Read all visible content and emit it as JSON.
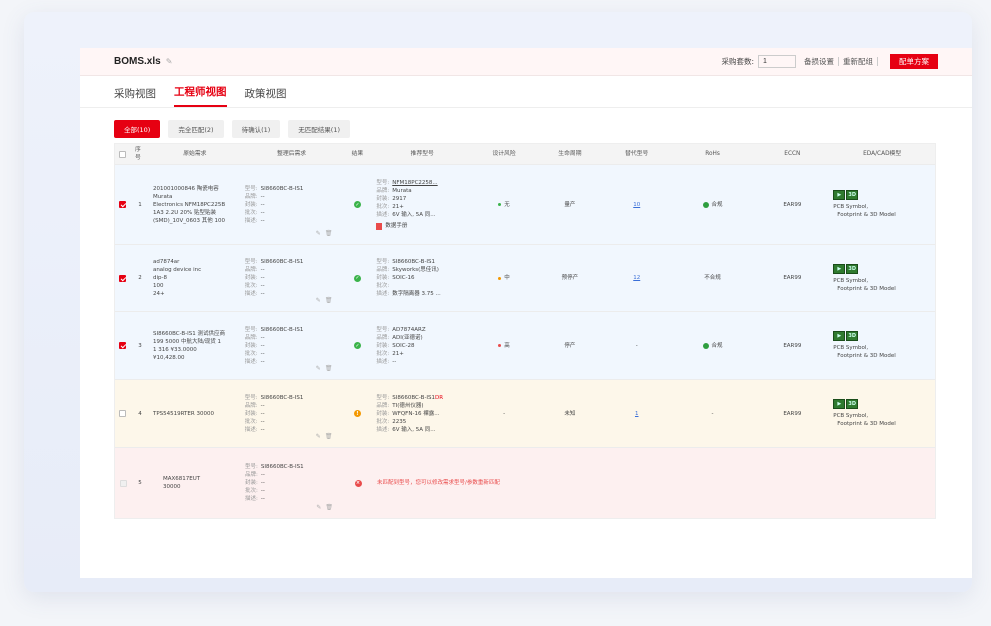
{
  "topbar": {
    "filename": "BOMS.xls",
    "qty_label": "采购套数:",
    "qty_value": "1",
    "loss_setting": "备损设置",
    "rematch": "重新配组",
    "order_plan": "配单方案"
  },
  "tabs": [
    "采购视图",
    "工程师视图",
    "政策视图"
  ],
  "filters": [
    "全部(10)",
    "完全匹配(2)",
    "待确认(1)",
    "无匹配结果(1)"
  ],
  "columns": {
    "idx": "序号",
    "orig": "原始需求",
    "req": "整理后需求",
    "res": "结果",
    "model": "推荐型号",
    "risk": "设计风险",
    "life": "生命周期",
    "alt": "替代型号",
    "rohs": "RoHs",
    "eccn": "ECCN",
    "eda": "EDA/CAD模型"
  },
  "labels": {
    "model": "型号:",
    "brand": "品牌:",
    "package": "封装:",
    "batch": "批次:",
    "desc": "描述:",
    "empty": "--",
    "datasheet": "数据手册",
    "eda_line1": "PCB Symbol,",
    "eda_line2": "Footprint & 3D Model",
    "rohs_ok": "合规",
    "no_match_msg": "未匹配到型号，您可以修改需求型号/参数重新匹配"
  },
  "rows": [
    {
      "idx": "1",
      "orig": [
        "201001000846 陶瓷电容",
        "Murata",
        "Electronics NFM18PC225B",
        "1A3 2.2U 20% 贴型贴装",
        "(SMD)_10V_0603 其他 100"
      ],
      "req_model": "SI8660BC-B-IS1",
      "model": {
        "model": "NFM18PC2258...",
        "brand": "Murata",
        "package": "2917",
        "batch": "21+",
        "desc": "6V 输入, 5A 同..."
      },
      "risk": "无",
      "risk_color": "#3bb34a",
      "life": "量产",
      "alt": "10",
      "rohs": "合规",
      "eccn": "EAR99"
    },
    {
      "idx": "2",
      "orig": [
        "ad7874ar",
        "analog device inc",
        "dip-8",
        "100",
        "24+"
      ],
      "req_model": "SI8660BC-B-IS1",
      "model": {
        "model": "SI8660BC-B-IS1",
        "brand": "Skyworks(思佳讯)",
        "package": "SOIC-16",
        "batch": "",
        "desc": "数字隔离器 3.75 ..."
      },
      "risk": "中",
      "risk_color": "#f39800",
      "life": "预停产",
      "alt": "12",
      "rohs": "不合规",
      "eccn": "EAR99"
    },
    {
      "idx": "3",
      "orig": [
        "SI8660BC-B-IS1 测试供应商",
        "199 5000 中航大陆/现货 1",
        "1 316 ¥33.0000",
        "¥10,428.00"
      ],
      "req_model": "SI8660BC-B-IS1",
      "model": {
        "model": "AD7874ARZ",
        "brand": "ADI(亚德诺)",
        "package": "SOIC-28",
        "batch": "21+",
        "desc": "--"
      },
      "risk": "高",
      "risk_color": "#e94b4b",
      "life": "停产",
      "alt": "-",
      "rohs": "合规",
      "eccn": "EAR99"
    },
    {
      "idx": "4",
      "orig": [
        "TPS54519RTER 30000"
      ],
      "req_model": "SI8660BC-B-IS1",
      "model": {
        "model": "SI8660BC-B-IS1",
        "model_suffix": "DR",
        "brand": "TI(德州仪器)",
        "package": "WFQFN-16 裸露...",
        "batch": "2235",
        "desc": "6V 输入, 5A 同..."
      },
      "risk": "-",
      "life": "未知",
      "alt": "1",
      "rohs": "-",
      "eccn": "EAR99"
    },
    {
      "idx": "5",
      "orig": [
        "MAX6817EUT",
        "30000"
      ],
      "req_model": "SI8660BC-B-IS1"
    }
  ]
}
